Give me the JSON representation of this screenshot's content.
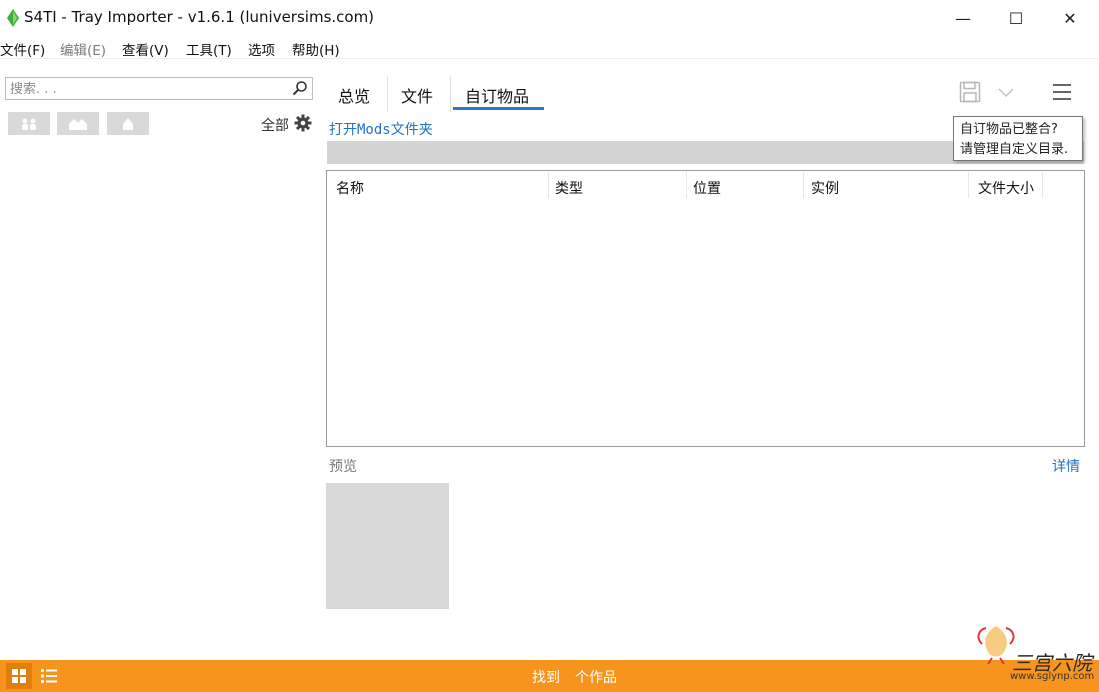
{
  "window": {
    "title": "S4TI - Tray Importer - v1.6.1  (luniversims.com)",
    "controls": {
      "minimize": "—",
      "maximize": "☐",
      "close": "✕"
    }
  },
  "menu": {
    "file": "文件(F)",
    "edit": "编辑(E)",
    "view": "查看(V)",
    "tools": "工具(T)",
    "options": "选项",
    "help": "帮助(H)"
  },
  "sidebar": {
    "search_placeholder": "搜索. . .",
    "all_label": "全部"
  },
  "tabs": [
    {
      "label": "总览"
    },
    {
      "label": "文件"
    },
    {
      "label": "自订物品",
      "active": true
    }
  ],
  "content": {
    "open_mods_link": "打开Mods文件夹",
    "tooltip_line1": "自订物品已整合?",
    "tooltip_line2": "请管理自定义目录.",
    "columns": [
      "名称",
      "类型",
      "位置",
      "实例",
      "文件大小"
    ],
    "preview_label": "预览",
    "details_link": "详情"
  },
  "footer": {
    "found": "找到",
    "count_label": "个作品"
  },
  "watermark": {
    "text": "三宫六院",
    "url": "www.sglynp.com"
  },
  "colors": {
    "accent": "#2b78c8",
    "footer": "#f7941d",
    "link": "#2272c0"
  }
}
